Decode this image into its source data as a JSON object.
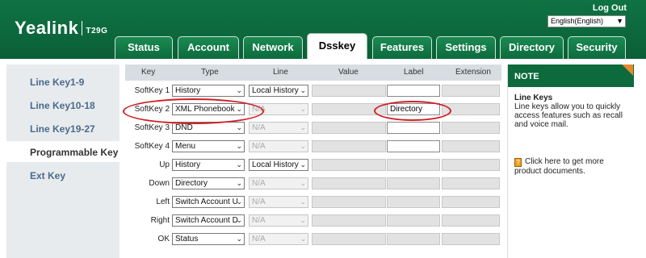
{
  "header": {
    "brand": "Yealink",
    "model": "T29G",
    "logout_label": "Log Out",
    "language": "English(English)"
  },
  "tabs": [
    {
      "label": "Status"
    },
    {
      "label": "Account"
    },
    {
      "label": "Network"
    },
    {
      "label": "Dsskey",
      "active": true
    },
    {
      "label": "Features"
    },
    {
      "label": "Settings"
    },
    {
      "label": "Directory"
    },
    {
      "label": "Security"
    }
  ],
  "sidebar": {
    "items": [
      {
        "label": "Line Key1-9"
      },
      {
        "label": "Line Key10-18"
      },
      {
        "label": "Line Key19-27"
      },
      {
        "label": "Programmable Key",
        "active": true
      },
      {
        "label": "Ext Key"
      }
    ]
  },
  "table": {
    "headers": [
      "Key",
      "Type",
      "Line",
      "Value",
      "Label",
      "Extension"
    ],
    "rows": [
      {
        "key": "SoftKey 1",
        "type": "History",
        "line": "Local History",
        "line_enabled": true,
        "label": "",
        "label_enabled": true
      },
      {
        "key": "SoftKey 2",
        "type": "XML Phonebook",
        "line": "N/A",
        "line_enabled": false,
        "label": "Directory",
        "label_enabled": true
      },
      {
        "key": "SoftKey 3",
        "type": "DND",
        "line": "N/A",
        "line_enabled": false,
        "label": "",
        "label_enabled": true
      },
      {
        "key": "SoftKey 4",
        "type": "Menu",
        "line": "N/A",
        "line_enabled": false,
        "label": "",
        "label_enabled": true
      },
      {
        "key": "Up",
        "type": "History",
        "line": "Local History",
        "line_enabled": true,
        "label": "",
        "label_enabled": false
      },
      {
        "key": "Down",
        "type": "Directory",
        "line": "N/A",
        "line_enabled": false,
        "label": "",
        "label_enabled": false
      },
      {
        "key": "Left",
        "type": "Switch Account U",
        "line": "N/A",
        "line_enabled": false,
        "label": "",
        "label_enabled": false
      },
      {
        "key": "Right",
        "type": "Switch Account D",
        "line": "N/A",
        "line_enabled": false,
        "label": "",
        "label_enabled": false
      },
      {
        "key": "OK",
        "type": "Status",
        "line": "N/A",
        "line_enabled": false,
        "label": "",
        "label_enabled": false
      }
    ]
  },
  "note": {
    "heading": "NOTE",
    "title": "Line Keys",
    "text": "Line keys allow you to quickly access features such as recall and voice mail.",
    "link_text": "Click here to get more product documents."
  },
  "colors": {
    "brand_green": "#0d6a3d",
    "annotation_red": "#d11f26",
    "note_accent": "#e8892b"
  }
}
